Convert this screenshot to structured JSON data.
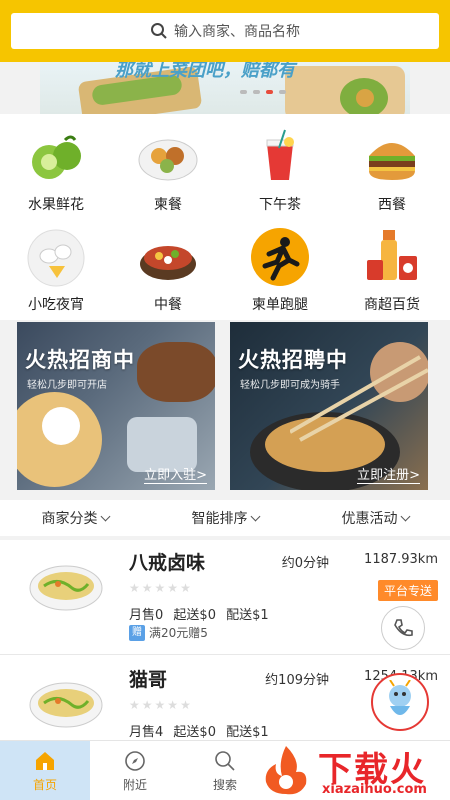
{
  "search": {
    "placeholder": "输入商家、商品名称"
  },
  "banner": {
    "partial_title": "那就上菜团吧，赔都有"
  },
  "categories": [
    {
      "label": "水果鲜花",
      "icon": "fruit-icon"
    },
    {
      "label": "柬餐",
      "icon": "cambodian-food-icon"
    },
    {
      "label": "下午茶",
      "icon": "afternoon-tea-icon"
    },
    {
      "label": "西餐",
      "icon": "burger-icon"
    },
    {
      "label": "小吃夜宵",
      "icon": "snack-icon"
    },
    {
      "label": "中餐",
      "icon": "chinese-food-icon"
    },
    {
      "label": "柬单跑腿",
      "icon": "runner-icon"
    },
    {
      "label": "商超百货",
      "icon": "supermarket-icon"
    }
  ],
  "promos": [
    {
      "title": "火热招商中",
      "subtitle": "轻松几步即可开店",
      "cta": "立即入驻>"
    },
    {
      "title": "火热招聘中",
      "subtitle": "轻松几步即可成为骑手",
      "cta": "立即注册>"
    }
  ],
  "filters": [
    {
      "label": "商家分类"
    },
    {
      "label": "智能排序"
    },
    {
      "label": "优惠活动"
    }
  ],
  "stores": [
    {
      "name": "八戒卤味",
      "time": "约0分钟",
      "distance": "1187.93km",
      "monthly_sales": "月售0",
      "min_order": "起送$0",
      "delivery_fee": "配送$1",
      "badge": "平台专送",
      "gift_tag": "赠",
      "promo_text": "满20元赠5"
    },
    {
      "name": "猫哥",
      "time": "约109分钟",
      "distance": "1254.13km",
      "monthly_sales": "月售4",
      "min_order": "起送$0",
      "delivery_fee": "配送$1"
    }
  ],
  "tabs": [
    {
      "label": "首页",
      "icon": "home-icon",
      "active": true
    },
    {
      "label": "附近",
      "icon": "compass-icon",
      "active": false
    },
    {
      "label": "搜索",
      "icon": "search-icon",
      "active": false
    }
  ],
  "watermark": {
    "title": "下载火",
    "url": "xiazaihuo.com"
  },
  "colors": {
    "brand_yellow": "#f6c500",
    "accent_orange": "#ff8a2a",
    "tab_active_bg": "#cfe4f6"
  }
}
